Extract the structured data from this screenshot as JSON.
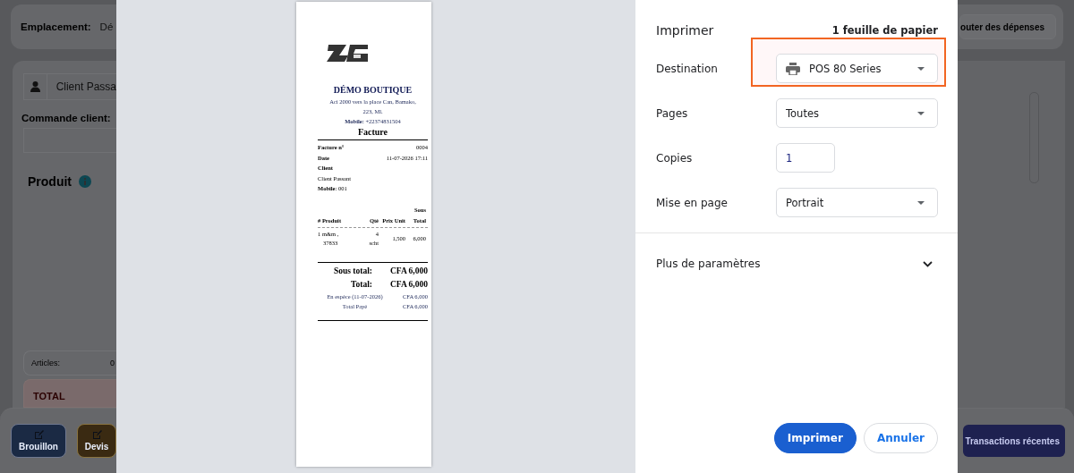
{
  "background_app": {
    "location_label": "Emplacement:",
    "location_value": "Dé",
    "client_field": "Client Passa",
    "order_label": "Commande client:",
    "product_heading": "Produit",
    "articles_label": "Articles:",
    "articles_value": "0",
    "total_label": "TOTAL",
    "buttons": [
      {
        "label": "Brouillon",
        "color": "#1b2a44"
      },
      {
        "label": "Devis",
        "color": "#3a2a12"
      }
    ],
    "expenses_button": "outer des dépenses",
    "recent_button": "Transactions récentes"
  },
  "receipt": {
    "shop_name": "DÉMO BOUTIQUE",
    "address_lines": [
      "Aci 2000 vers la place Can, Bamako,",
      "223, Ml."
    ],
    "mobile_label": "Mobile:",
    "mobile_value": "+22374831504",
    "doc_title": "Facture",
    "info_rows": [
      {
        "label": "Facture n°",
        "value": "0004"
      },
      {
        "label": "Date",
        "value": "11-07-2026 17:11"
      },
      {
        "label": "Client",
        "value": ""
      }
    ],
    "client_name": "Client Passant",
    "client_mobile_label": "Mobile",
    "client_mobile_value": ": 001",
    "columns": [
      "# Produit",
      "Qté",
      "Prix Unit",
      "Sous Total"
    ],
    "items": [
      {
        "product": "1 m&m ,",
        "code": "37833",
        "qty": "4",
        "unit": "scht",
        "price": "1,500",
        "subtotal": "6,000"
      }
    ],
    "totals": [
      {
        "kind": "big",
        "label": "Sous total:",
        "value": "CFA 6,000"
      },
      {
        "kind": "big",
        "label": "Total:",
        "value": "CFA 6,000"
      },
      {
        "kind": "small",
        "label": "En espèce (11-07-2026)",
        "value": "CFA 6,000"
      },
      {
        "kind": "small",
        "label": "Total Payé",
        "value": "CFA 6,000"
      }
    ]
  },
  "print_settings": {
    "title": "Imprimer",
    "sheets": "1 feuille de papier",
    "fields": [
      {
        "label": "Destination",
        "kind": "select",
        "value": "POS 80 Series",
        "printer_icon": true,
        "highlighted": true
      },
      {
        "label": "Pages",
        "kind": "select",
        "value": "Toutes",
        "printer_icon": false,
        "highlighted": false
      },
      {
        "label": "Copies",
        "kind": "number",
        "value": "1",
        "printer_icon": false,
        "highlighted": false
      },
      {
        "label": "Mise en page",
        "kind": "select",
        "value": "Portrait",
        "printer_icon": false,
        "highlighted": false
      }
    ],
    "more_settings": "Plus de paramètres",
    "expanded": false,
    "buttons": [
      {
        "label": "Imprimer",
        "primary": true
      },
      {
        "label": "Annuler",
        "primary": false
      }
    ]
  }
}
